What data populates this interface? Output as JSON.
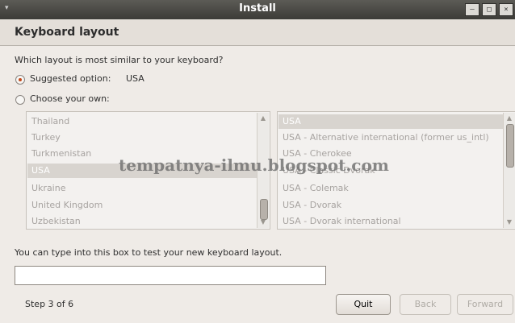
{
  "window": {
    "title": "Install"
  },
  "header": {
    "title": "Keyboard layout"
  },
  "question": "Which layout is most similar to your keyboard?",
  "suggested": {
    "label": "Suggested option:",
    "value": "USA"
  },
  "choose_own": {
    "label": "Choose your own:"
  },
  "left_list": {
    "items": [
      "Thailand",
      "Turkey",
      "Turkmenistan",
      "USA",
      "Ukraine",
      "United Kingdom",
      "Uzbekistan"
    ],
    "selected": "USA"
  },
  "right_list": {
    "items": [
      "USA",
      "USA - Alternative international (former us_intl)",
      "USA - Cherokee",
      "USA - Classic Dvorak",
      "USA - Colemak",
      "USA - Dvorak",
      "USA - Dvorak international"
    ],
    "selected": "USA"
  },
  "watermark": "tempatnya-ilmu.blogspot.com",
  "test_label": "You can type into this box to test your new keyboard layout.",
  "test_input_value": "",
  "step": "Step 3 of 6",
  "buttons": {
    "quit": "Quit",
    "back": "Back",
    "forward": "Forward"
  },
  "window_buttons": {
    "minimize": "–",
    "maximize": "□",
    "close": "×"
  }
}
